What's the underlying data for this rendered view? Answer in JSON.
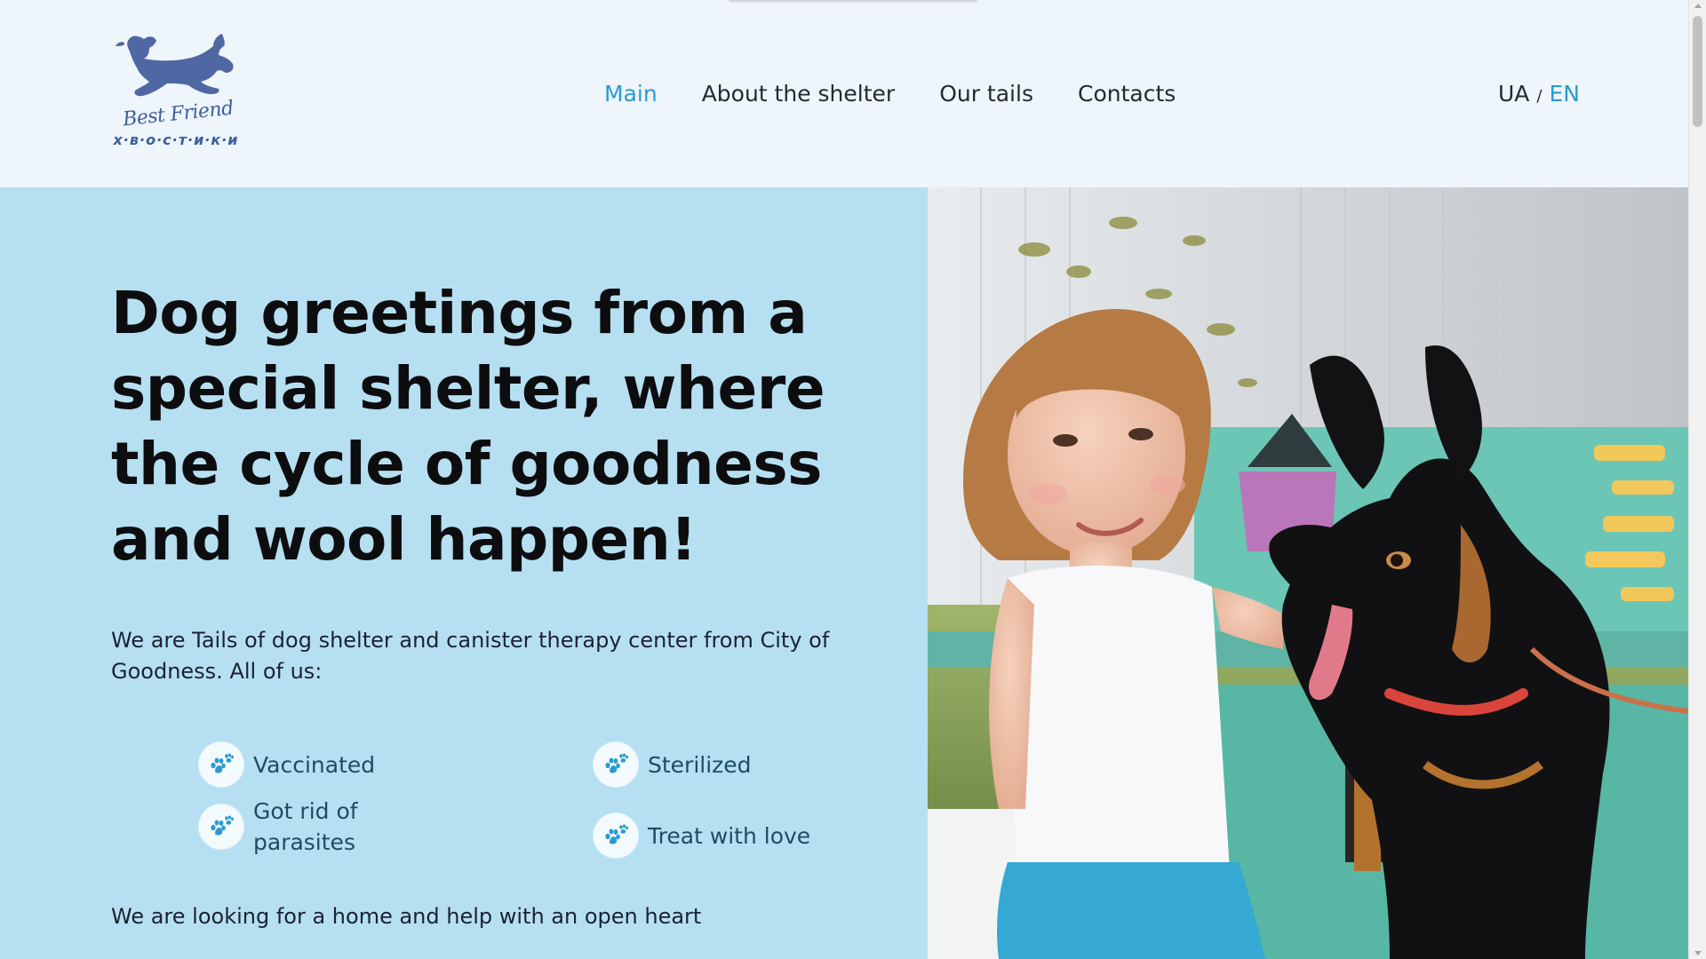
{
  "header": {
    "logo": {
      "script_text": "Best Friend",
      "word_text": "x·в·о·с·т·и·к·и",
      "icon": "dog-logo-icon"
    },
    "nav": [
      {
        "label": "Main",
        "active": true
      },
      {
        "label": "About the shelter",
        "active": false
      },
      {
        "label": "Our tails",
        "active": false
      },
      {
        "label": "Contacts",
        "active": false
      }
    ],
    "lang": {
      "ua": "UA",
      "separator": "/",
      "en": "EN",
      "active": "EN"
    }
  },
  "hero": {
    "title": "Dog greetings from a special shelter, where the cycle of goodness and wool happen!",
    "intro": "We are Tails of dog shelter and canister therapy center from City of Goodness. All of us:",
    "features": [
      {
        "label": "Vaccinated",
        "icon": "paw-icon"
      },
      {
        "label": "Sterilized",
        "icon": "paw-icon"
      },
      {
        "label": "Got rid of parasites",
        "icon": "paw-icon"
      },
      {
        "label": "Treat with love",
        "icon": "paw-icon"
      }
    ],
    "closing": "We are looking for a home and help with an open heart",
    "photo_icon": "child-with-dog-photo"
  },
  "colors": {
    "page_bg": "#eef5fb",
    "hero_bg": "#b6e0f1",
    "accent": "#2c9ad0",
    "logo": "#3f5f9e",
    "feature_text": "#1f4c63"
  }
}
